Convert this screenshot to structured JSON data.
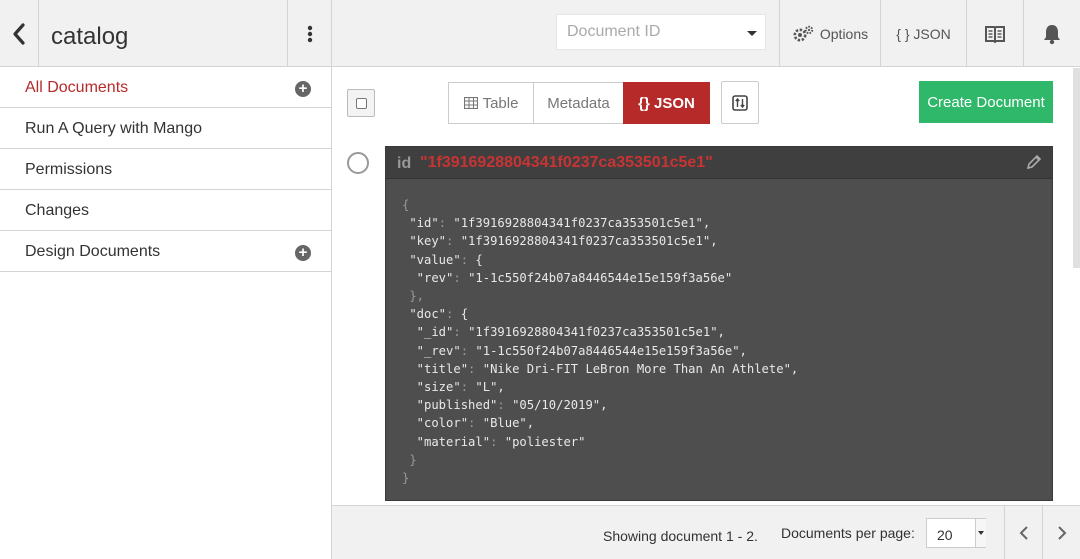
{
  "sidebar": {
    "title": "catalog",
    "items": [
      {
        "label": "All Documents",
        "active": true,
        "has_add": true
      },
      {
        "label": "Run A Query with Mango",
        "active": false,
        "has_add": false
      },
      {
        "label": "Permissions",
        "active": false,
        "has_add": false
      },
      {
        "label": "Changes",
        "active": false,
        "has_add": false
      },
      {
        "label": "Design Documents",
        "active": false,
        "has_add": true
      }
    ]
  },
  "header": {
    "doc_id_placeholder": "Document ID",
    "options_label": "Options",
    "json_label": "{ } JSON",
    "icons": {
      "options": "gears-icon",
      "docs": "book-icon",
      "notifications": "bell-icon"
    }
  },
  "toolbar": {
    "views": [
      {
        "label": "Table",
        "icon": "table-icon",
        "active": false
      },
      {
        "label": "Metadata",
        "active": false
      },
      {
        "label": "{} JSON",
        "active": true
      }
    ],
    "create_label": "Create Document"
  },
  "document": {
    "id_label": "id",
    "id_value": "\"1f3916928804341f0237ca353501c5e1\"",
    "json_lines": [
      {
        "indent": 0,
        "text": "{",
        "punct": true
      },
      {
        "indent": 1,
        "key": "\"id\"",
        "val": "\"1f3916928804341f0237ca353501c5e1\","
      },
      {
        "indent": 1,
        "key": "\"key\"",
        "val": "\"1f3916928804341f0237ca353501c5e1\","
      },
      {
        "indent": 1,
        "key": "\"value\"",
        "val": "{"
      },
      {
        "indent": 2,
        "key": "\"rev\"",
        "val": "\"1-1c550f24b07a8446544e15e159f3a56e\""
      },
      {
        "indent": 1,
        "text": "},",
        "punct": true
      },
      {
        "indent": 1,
        "key": "\"doc\"",
        "val": "{"
      },
      {
        "indent": 2,
        "key": "\"_id\"",
        "val": "\"1f3916928804341f0237ca353501c5e1\","
      },
      {
        "indent": 2,
        "key": "\"_rev\"",
        "val": "\"1-1c550f24b07a8446544e15e159f3a56e\","
      },
      {
        "indent": 2,
        "key": "\"title\"",
        "val": "\"Nike Dri-FIT LeBron More Than An Athlete\","
      },
      {
        "indent": 2,
        "key": "\"size\"",
        "val": "\"L\","
      },
      {
        "indent": 2,
        "key": "\"published\"",
        "val": "\"05/10/2019\","
      },
      {
        "indent": 2,
        "key": "\"color\"",
        "val": "\"Blue\","
      },
      {
        "indent": 2,
        "key": "\"material\"",
        "val": "\"poliester\""
      },
      {
        "indent": 1,
        "text": "}",
        "punct": true
      },
      {
        "indent": 0,
        "text": "}",
        "punct": true
      }
    ]
  },
  "footer": {
    "showing": "Showing document 1 - 2.",
    "per_page_label": "Documents per page:",
    "per_page_value": "20"
  },
  "colors": {
    "accent_red": "#b72a2a",
    "create_green": "#2fb86a",
    "doc_bg": "#4e4e4e"
  }
}
